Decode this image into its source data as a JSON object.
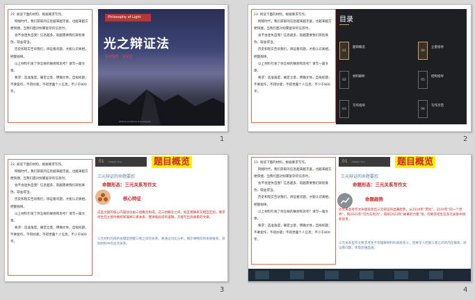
{
  "prompt": {
    "paragraphs": [
      "23. 阅读下面的材料，根据要求写作。",
      "网络时代，我们获取的信息越来越丰富，也越来越方便快捷。当我们面对纷繁复杂的信息时，",
      "会不会迷失自我？信息越多，就越需要我们辨别真伪、取舍得当。",
      "历史和现实告诉我们，辨证看问题，才能认识真相，把握规律。",
      "以上材料引发了你怎样的联想和思考？请写一篇文章。",
      "要求：选准角度，确定立意，明确文体，自拟标题；不要套作，不得抄袭；不得泄露个人信息；不少于800字。"
    ]
  },
  "slides": [
    {
      "number": "1",
      "cover": {
        "bar_text": "Philosophy of Light",
        "title": "光之辩证法",
        "subtitle": "写作指导 · 议论文",
        "footer": "Writing Guidance and Analysis"
      }
    },
    {
      "number": "2",
      "toc": {
        "heading": "目录",
        "items": [
          {
            "no": "01",
            "label": "题目概览",
            "gold": true
          },
          {
            "no": "02",
            "label": "材料解析",
            "gold": false
          },
          {
            "no": "03",
            "label": "写作指导",
            "gold": false
          },
          {
            "no": "04",
            "label": "立意指导",
            "gold": true
          },
          {
            "no": "05",
            "label": "结构指导",
            "gold": false
          },
          {
            "no": "06",
            "label": "写作示范",
            "gold": false
          }
        ]
      }
    },
    {
      "number": "3",
      "section_no": "01",
      "section_small": "Chapter One",
      "big_title": "题目概览",
      "sub": "三元辩证的命题要怼",
      "head1": "命题形态：三元关系写作文",
      "head2": "核心特征",
      "red_text": "这些文题的核心内容往往由三组概念构成，这三组概念之间，既互相联系又相互区别，要求考生在立意时要统筹兼顾三者关系，厘清彼此间的逻辑，方能写出高质量的文章。",
      "blue_text": "三元材料的辨析关键是把握三者之间的关系，要通过对比分析，揭示事物间的本质联系，辨别材料中的主次关系。"
    },
    {
      "number": "4",
      "section_no": "01",
      "section_small": "Chapter One",
      "big_title": "题目概览",
      "sub": "三元辩证的命题要怼",
      "head1": "命题形态：三元关系写作文",
      "head2": "命题趋势",
      "red_text": "近年来高考作文命题表现出三元辩证的显著趋势，从2019年“劳动”、2020年“同一个世界”，到2021年“可为与有为”，再到2023年“故事的力量”等，均要求考生在多元关系中辨析思考。",
      "blue_text": "三元关系型作文要求考生不仅理解材料的表层含义，还要深入挖掘三者之间的内在联系，辩证看问题，体现思维品质。"
    }
  ]
}
